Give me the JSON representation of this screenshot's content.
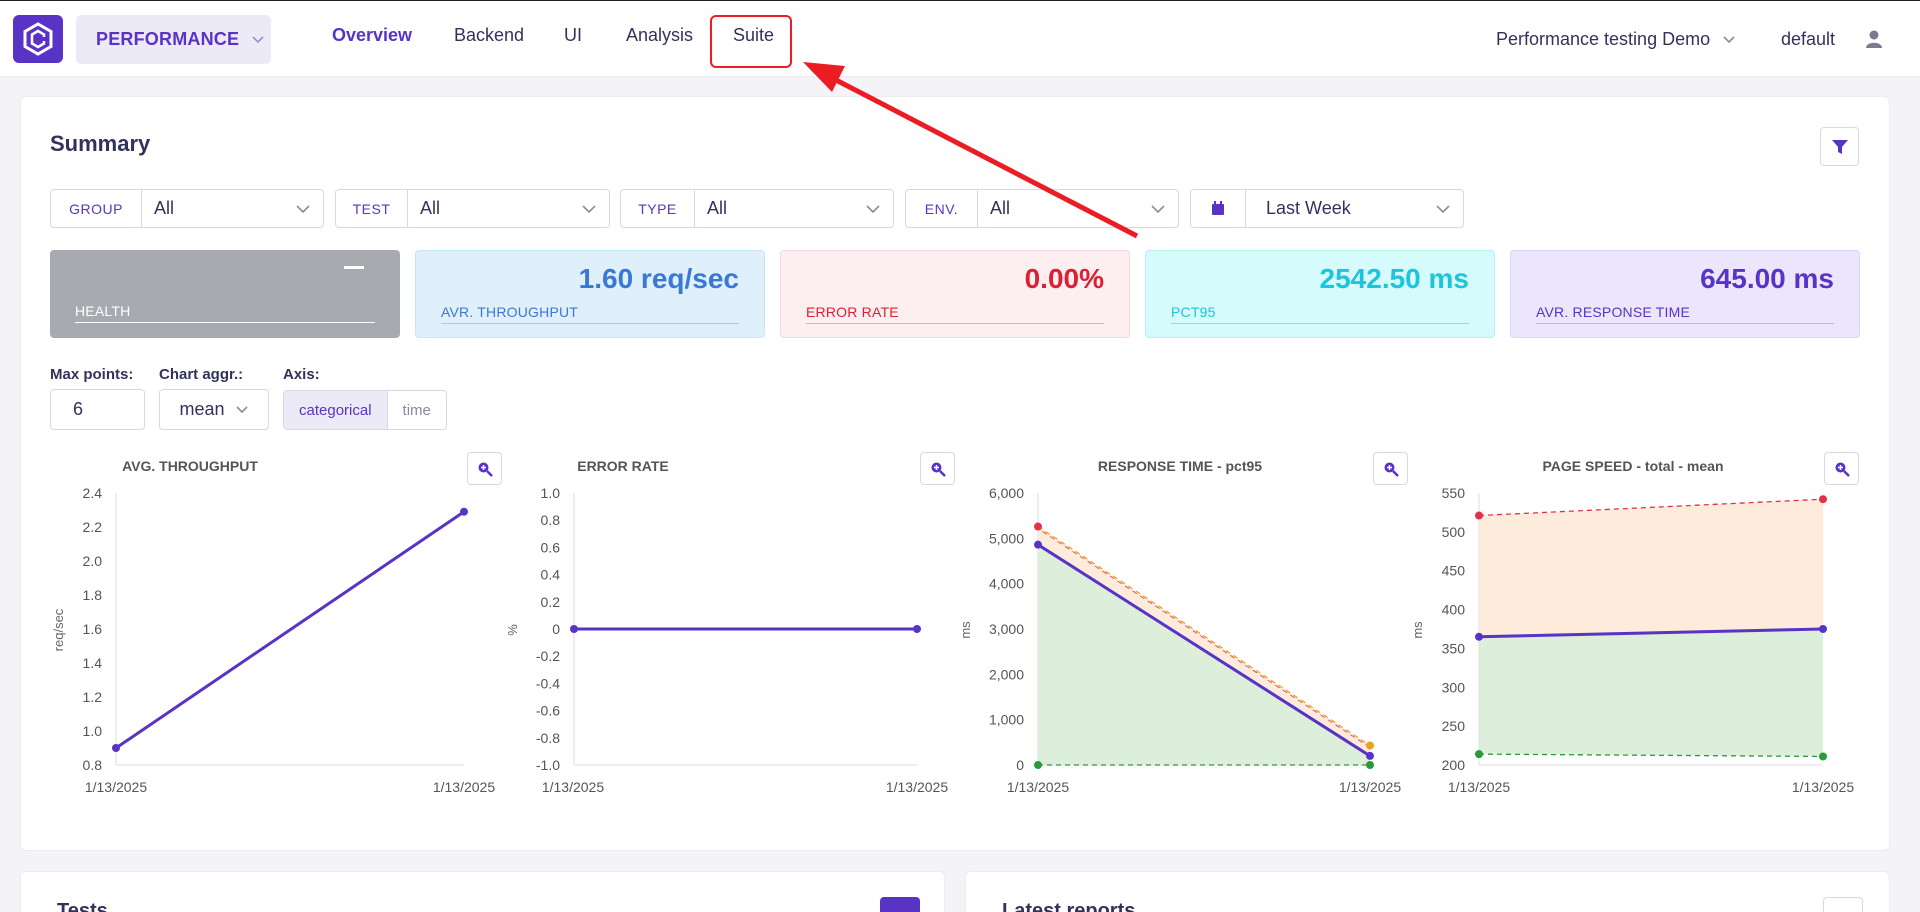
{
  "nav": {
    "module": "PERFORMANCE",
    "items": [
      "Overview",
      "Backend",
      "UI",
      "Analysis",
      "Suite"
    ],
    "project": "Performance testing Demo",
    "user": "default"
  },
  "summary": {
    "title": "Summary",
    "filters": [
      {
        "label": "GROUP",
        "value": "All"
      },
      {
        "label": "TEST",
        "value": "All"
      },
      {
        "label": "TYPE",
        "value": "All"
      },
      {
        "label": "ENV.",
        "value": "All"
      }
    ],
    "date_range": "Last Week",
    "stats": [
      {
        "label": "HEALTH",
        "value": ""
      },
      {
        "label": "AVR. THROUGHPUT",
        "value": "1.60 req/sec"
      },
      {
        "label": "ERROR RATE",
        "value": "0.00%"
      },
      {
        "label": "PCT95",
        "value": "2542.50 ms"
      },
      {
        "label": "AVR. RESPONSE TIME",
        "value": "645.00 ms"
      }
    ],
    "controls": {
      "max_points_label": "Max points:",
      "max_points": "6",
      "aggr_label": "Chart aggr.:",
      "aggr": "mean",
      "axis_label": "Axis:",
      "axis_options": [
        "categorical",
        "time"
      ],
      "axis_selected": "categorical"
    }
  },
  "colors": {
    "accent": "#5933c6",
    "error": "#dc1f35",
    "pct95": "#1cc4dc",
    "throughput": "#3a78d8",
    "health_bg": "#a7abaf",
    "annotation": "#ec1c24"
  },
  "chart_data": [
    {
      "type": "line",
      "title": "AVG. THROUGHPUT",
      "ylabel": "req/sec",
      "categories": [
        "1/13/2025",
        "1/13/2025"
      ],
      "series": [
        {
          "values": [
            0.9,
            2.29
          ]
        }
      ],
      "ylim": [
        0.8,
        2.4
      ],
      "yticks": [
        "0.8",
        "1.0",
        "1.2",
        "1.4",
        "1.6",
        "1.8",
        "2.0",
        "2.2",
        "2.4"
      ]
    },
    {
      "type": "line",
      "title": "ERROR RATE",
      "ylabel": "%",
      "categories": [
        "1/13/2025",
        "1/13/2025"
      ],
      "series": [
        {
          "values": [
            0,
            0
          ]
        }
      ],
      "ylim": [
        -1.0,
        1.0
      ],
      "yticks": [
        "-1.0",
        "-0.8",
        "-0.6",
        "-0.4",
        "-0.2",
        "0",
        "0.2",
        "0.4",
        "0.6",
        "0.8",
        "1.0"
      ]
    },
    {
      "type": "area",
      "title": "RESPONSE TIME - pct95",
      "ylabel": "ms",
      "categories": [
        "1/13/2025",
        "1/13/2025"
      ],
      "series": [
        {
          "values": [
            5260,
            430
          ]
        },
        {
          "values": [
            4860,
            200
          ]
        },
        {
          "values": [
            0,
            0
          ]
        }
      ],
      "ylim": [
        0,
        6000
      ],
      "yticks": [
        "0",
        "1,000",
        "2,000",
        "3,000",
        "4,000",
        "5,000",
        "6,000"
      ]
    },
    {
      "type": "area",
      "title": "PAGE SPEED - total - mean",
      "ylabel": "ms",
      "categories": [
        "1/13/2025",
        "1/13/2025"
      ],
      "series": [
        {
          "values": [
            521,
            542
          ]
        },
        {
          "values": [
            365,
            375
          ]
        },
        {
          "values": [
            214,
            211
          ]
        }
      ],
      "ylim": [
        200,
        550
      ],
      "yticks": [
        "200",
        "250",
        "300",
        "350",
        "400",
        "450",
        "500",
        "550"
      ]
    }
  ],
  "bottom": {
    "tests_title": "Tests",
    "reports_title": "Latest reports"
  }
}
